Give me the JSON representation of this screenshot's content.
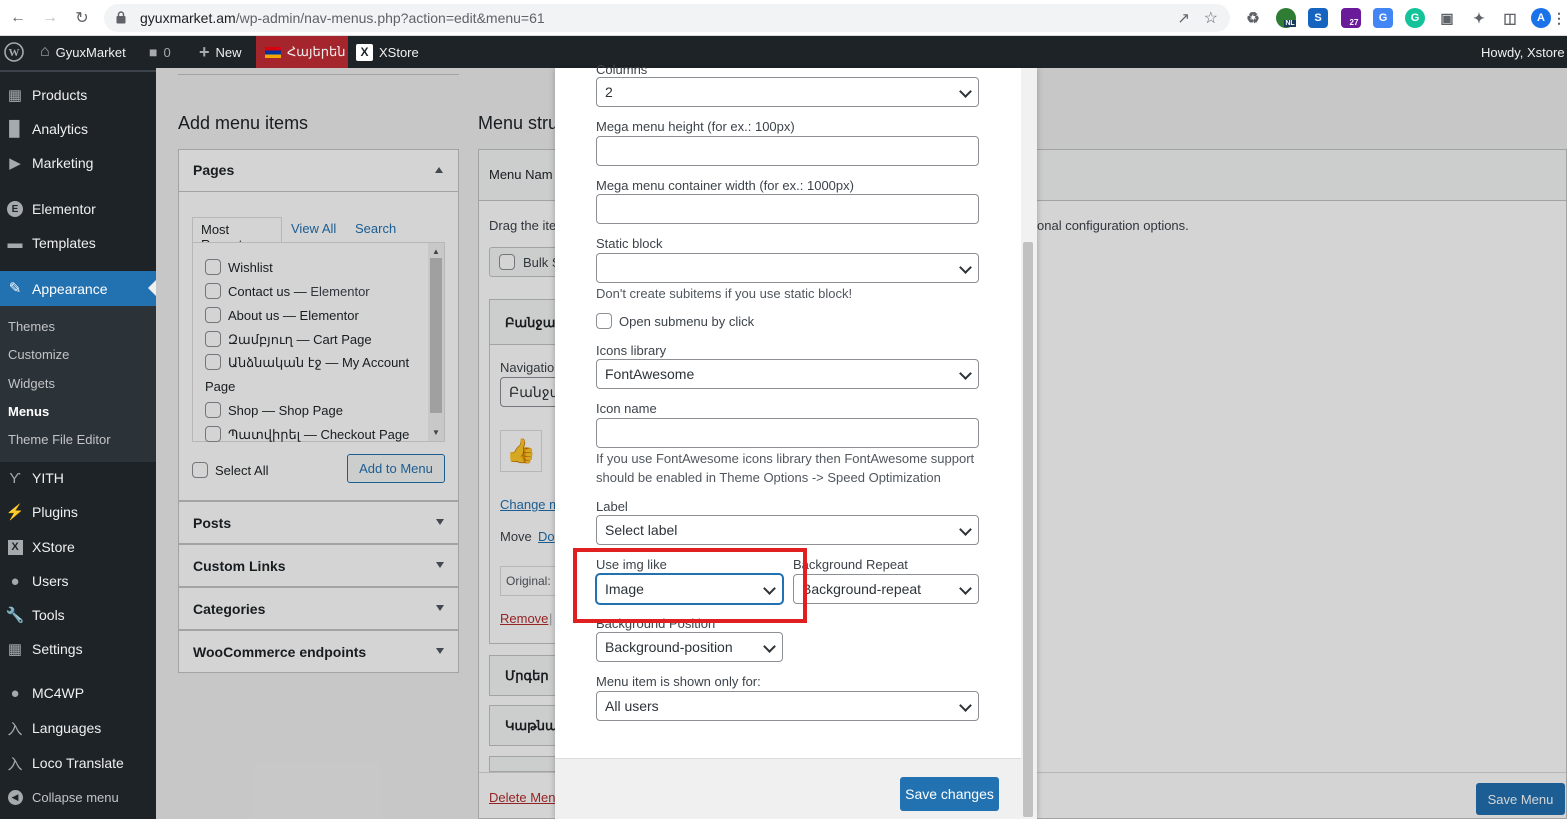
{
  "browser": {
    "url_host": "gyuxmarket.am",
    "url_path": "/wp-admin/nav-menus.php?action=edit&menu=61",
    "ext_badge_nl": "NL",
    "ext_badge_27": "27",
    "profile_initial": "A"
  },
  "adminbar": {
    "site_name": "GyuxMarket",
    "comments_count": "0",
    "new_label": "New",
    "language_label": "Հայերեն",
    "theme_label": "XStore",
    "howdy": "Howdy, Xstore"
  },
  "sidebar": {
    "items": [
      {
        "label": "Products",
        "icon": "archive-icon"
      },
      {
        "label": "Analytics",
        "icon": "bar-chart-icon"
      },
      {
        "label": "Marketing",
        "icon": "megaphone-icon"
      },
      {
        "label": "Elementor",
        "icon": "elementor-icon"
      },
      {
        "label": "Templates",
        "icon": "folder-icon"
      },
      {
        "label": "Appearance",
        "icon": "brush-icon"
      },
      {
        "label": "YITH",
        "icon": "yith-icon"
      },
      {
        "label": "Plugins",
        "icon": "plug-icon"
      },
      {
        "label": "XStore",
        "icon": "xstore-icon"
      },
      {
        "label": "Users",
        "icon": "user-icon"
      },
      {
        "label": "Tools",
        "icon": "wrench-icon"
      },
      {
        "label": "Settings",
        "icon": "sliders-icon"
      },
      {
        "label": "MC4WP",
        "icon": "mc4wp-icon"
      },
      {
        "label": "Languages",
        "icon": "translate-icon"
      },
      {
        "label": "Loco Translate",
        "icon": "loco-icon"
      },
      {
        "label": "Collapse menu",
        "icon": "collapse-icon"
      }
    ],
    "submenu": [
      "Themes",
      "Customize",
      "Widgets",
      "Menus",
      "Theme File Editor"
    ]
  },
  "add_menu_items": {
    "heading": "Add menu items",
    "pages_title": "Pages",
    "tabs": [
      "Most Recent",
      "View All",
      "Search"
    ],
    "pages": [
      {
        "title": "Wishlist",
        "suffix": ""
      },
      {
        "title": "Contact us — ",
        "suffix": "Elementor"
      },
      {
        "title": "About us — ",
        "suffix": "Elementor"
      },
      {
        "title": "Զամբյուղ — ",
        "suffix": "Cart Page"
      },
      {
        "title": "Անձնական էջ — ",
        "suffix": "My Account"
      },
      {
        "title": "",
        "suffix": "Page"
      },
      {
        "title": "Shop — ",
        "suffix": "Shop Page"
      },
      {
        "title": "Պատվիրել — ",
        "suffix": "Checkout Page"
      }
    ],
    "select_all": "Select All",
    "add_button": "Add to Menu",
    "sections": [
      "Posts",
      "Custom Links",
      "Categories",
      "WooCommerce endpoints"
    ]
  },
  "menu_structure": {
    "heading": "Menu stru",
    "menu_name_label": "Menu Nam",
    "drag_text": "Drag the ite",
    "config_text": "onal configuration options.",
    "bulk": "Bulk S",
    "item1_title": "Բանջար",
    "nav_label": "Navigatio",
    "nav_value": "Բանջա",
    "change_link": "Change m",
    "move_label": "Move",
    "move_link": "Do",
    "original_label": "Original:",
    "remove_link": "Remove",
    "remove_sep": "|",
    "item2_title": "Մրգեր",
    "item3_title": "Կաթնա",
    "delete_link": "Delete Men",
    "save_menu": "Save Menu"
  },
  "modal": {
    "columns_label": "Columns",
    "columns_value": "2",
    "height_label": "Mega menu height (for ex.: 100px)",
    "height_value": "",
    "width_label": "Mega menu container width (for ex.: 1000px)",
    "width_value": "",
    "static_label": "Static block",
    "static_value": "",
    "static_hint": "Don't create subitems if you use static block!",
    "open_submenu": "Open submenu by click",
    "icons_lib_label": "Icons library",
    "icons_lib_value": "FontAwesome",
    "icon_name_label": "Icon name",
    "icon_name_value": "",
    "icon_hint_1": "If you use FontAwesome icons library then FontAwesome support",
    "icon_hint_2": "should be enabled in Theme Options -> Speed Optimization",
    "label_label": "Label",
    "label_value": "Select label",
    "use_img_label": "Use img like",
    "use_img_value": "Image",
    "bg_repeat_label": "Background Repeat",
    "bg_repeat_value": "Background-repeat",
    "bg_position_label": "Background Position",
    "bg_position_value": "Background-position",
    "shown_for_label": "Menu item is shown only for:",
    "shown_for_value": "All users",
    "save_changes": "Save changes"
  },
  "colors": {
    "admin_dark": "#1d2327",
    "accent_blue": "#2271b1",
    "highlight_red": "#e02020",
    "language_bg": "#a4262c"
  }
}
